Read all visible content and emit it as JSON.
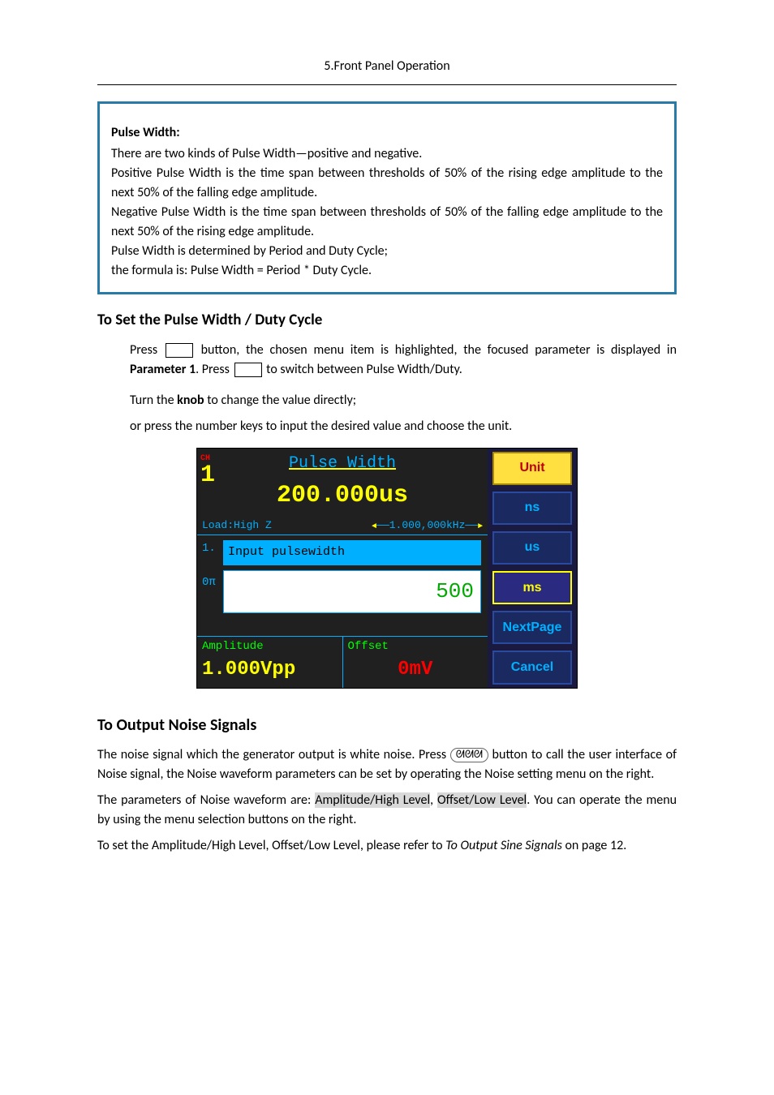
{
  "header": {
    "text": "5.Front Panel Operation"
  },
  "infobox": {
    "title": "Pulse Width:",
    "l1": "There are two kinds of Pulse Width—positive and negative.",
    "l2": "Positive Pulse Width is the time span between thresholds of 50% of the rising edge amplitude to the next 50% of the falling edge amplitude.",
    "l3": "Negative Pulse Width is the time span between thresholds of 50% of the falling edge amplitude to the next 50% of the rising edge amplitude.",
    "l4": "Pulse Width is determined by Period and Duty Cycle;",
    "l5": "the formula is: Pulse Width = Period * Duty Cycle."
  },
  "section1": {
    "heading": "To Set the Pulse Width / Duty Cycle",
    "p1a": "Press ",
    "p1b": " button, the chosen menu item is highlighted, the focused parameter is displayed in ",
    "p1c": "Parameter 1",
    "p1d": ". Press ",
    "p1e": " to switch between Pulse Width/Duty.",
    "p2a": "Turn the ",
    "p2b": "knob",
    "p2c": " to change the value directly;",
    "p3": "or press the number keys to input the desired value and choose the unit."
  },
  "device": {
    "ch_label": "CH",
    "ch_num": "1",
    "title": "Pulse Width",
    "main_value": "200.000us",
    "load": "Load:High Z",
    "freq": "1.000,000kHz",
    "num1": "1.",
    "num2": "0π",
    "input_label": "Input pulsewidth",
    "input_value": "500",
    "amp_label": "Amplitude",
    "amp_value": "1.000Vpp",
    "off_label": "Offset",
    "off_value": "0mV",
    "menu": {
      "unit": "Unit",
      "ns": "ns",
      "us": "us",
      "ms": "ms",
      "next": "NextPage",
      "cancel": "Cancel"
    }
  },
  "section2": {
    "heading": "To Output Noise Signals",
    "p1a": "The noise signal which the generator output is white noise. Press ",
    "p1b": " button to call the user interface of Noise signal, the Noise waveform parameters can be set by operating the Noise setting menu on the right.",
    "p2a": "The parameters of Noise waveform are: ",
    "p2b": "Amplitude/High Level",
    "p2c": ", ",
    "p2d": "Offset/Low Level",
    "p2e": ". You can operate the menu by using the menu selection buttons on the right.",
    "p3a": "To set the Amplitude/High Level, Offset/Low Level, please refer to ",
    "p3b": "To Output Sine Signals",
    "p3c": " on page 12."
  },
  "icons": {
    "noise": "ᘛᘛᘛ"
  }
}
